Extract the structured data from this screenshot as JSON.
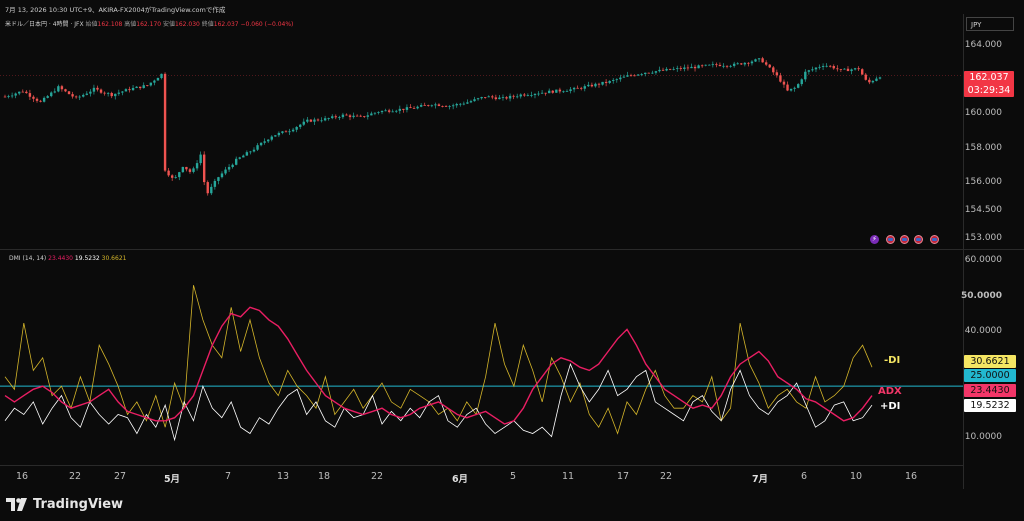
{
  "header": {
    "timestamp": "7月 13, 2026 10:30 UTC+9、AKIRA-FX2004がTradingView.comで作成",
    "symbol": "米ドル／日本円 · 4時間 · JFX",
    "ohlc_labels": {
      "open": "始値",
      "high": "高値",
      "low": "安値",
      "close": "終値"
    },
    "ohlc_values": {
      "open": "162.108",
      "high": "162.170",
      "low": "162.030",
      "close": "162.037"
    },
    "change": "−0.060 (−0.04%)"
  },
  "currency": "JPY",
  "price_axis": {
    "ticks": [
      "164.000",
      "162.000",
      "160.000",
      "158.000",
      "156.000",
      "154.500",
      "153.000"
    ],
    "current_price": "162.037",
    "countdown": "03:29:34"
  },
  "indicator": {
    "name": "DMI (14, 14)",
    "values": {
      "adx": "23.4430",
      "plus_di": "19.5232",
      "minus_di": "30.6621"
    },
    "axis_ticks": [
      "60.0000",
      "50.0000",
      "40.0000",
      "10.0000"
    ],
    "level_label": "25.0000",
    "legend": {
      "minus_di": "-DI",
      "adx": "ADX",
      "plus_di": "+DI"
    },
    "colors": {
      "adx": "#e91e63",
      "plus_di": "#ffffff",
      "minus_di": "#d4b52a",
      "level": "#22b8cf"
    }
  },
  "x_axis": {
    "labels": [
      "16",
      "22",
      "27",
      "5月",
      "7",
      "13",
      "18",
      "22",
      "6月",
      "5",
      "11",
      "17",
      "22",
      "7月",
      "6",
      "10",
      "16"
    ]
  },
  "branding": {
    "logo_text": "TradingView"
  },
  "chart_data": [
    {
      "type": "candlestick",
      "title": "米ドル／日本円 · 4時間 · JFX",
      "ylim": [
        152.8,
        165.0
      ],
      "period_range": [
        "16",
        "16"
      ],
      "points_approx": [
        [
          0,
          160.9
        ],
        [
          10,
          161.2
        ],
        [
          20,
          160.6
        ],
        [
          30,
          161.4
        ],
        [
          40,
          160.8
        ],
        [
          50,
          161.3
        ],
        [
          60,
          161.0
        ],
        [
          70,
          161.3
        ],
        [
          80,
          161.5
        ],
        [
          88,
          162.1
        ],
        [
          90,
          157.0
        ],
        [
          95,
          156.4
        ],
        [
          100,
          157.2
        ],
        [
          105,
          156.8
        ],
        [
          110,
          157.8
        ],
        [
          113,
          155.6
        ],
        [
          120,
          156.6
        ],
        [
          130,
          157.5
        ],
        [
          140,
          158.1
        ],
        [
          150,
          158.8
        ],
        [
          160,
          159.1
        ],
        [
          170,
          159.6
        ],
        [
          180,
          159.7
        ],
        [
          190,
          159.9
        ],
        [
          200,
          159.8
        ],
        [
          210,
          160.1
        ],
        [
          220,
          160.2
        ],
        [
          230,
          160.3
        ],
        [
          240,
          160.5
        ],
        [
          250,
          160.4
        ],
        [
          260,
          160.6
        ],
        [
          270,
          160.9
        ],
        [
          280,
          160.8
        ],
        [
          290,
          161.0
        ],
        [
          300,
          161.1
        ],
        [
          310,
          161.2
        ],
        [
          320,
          161.3
        ],
        [
          330,
          161.5
        ],
        [
          340,
          161.7
        ],
        [
          350,
          162.0
        ],
        [
          360,
          162.2
        ],
        [
          370,
          162.3
        ],
        [
          380,
          162.4
        ],
        [
          390,
          162.5
        ],
        [
          400,
          162.6
        ],
        [
          410,
          162.6
        ],
        [
          420,
          162.8
        ],
        [
          425,
          162.9
        ],
        [
          430,
          162.4
        ],
        [
          435,
          161.9
        ],
        [
          440,
          161.2
        ],
        [
          445,
          161.4
        ],
        [
          450,
          162.2
        ],
        [
          460,
          162.6
        ],
        [
          465,
          162.5
        ],
        [
          470,
          162.3
        ],
        [
          480,
          162.4
        ],
        [
          485,
          161.6
        ],
        [
          490,
          161.9
        ],
        [
          492,
          162.0
        ]
      ]
    },
    {
      "type": "line",
      "title": "DMI (14, 14)",
      "ylim": [
        0,
        65
      ],
      "reference_line": 25,
      "series": [
        {
          "name": "ADX",
          "values": [
            22,
            20,
            22,
            24,
            25,
            23,
            20,
            18,
            19,
            20,
            22,
            24,
            20,
            17,
            16,
            15,
            14,
            14,
            15,
            18,
            22,
            30,
            38,
            44,
            48,
            47,
            50,
            49,
            46,
            44,
            40,
            35,
            30,
            26,
            22,
            20,
            18,
            17,
            16,
            17,
            18,
            16,
            15,
            16,
            18,
            19,
            20,
            18,
            16,
            15,
            16,
            17,
            15,
            13,
            14,
            18,
            24,
            28,
            32,
            34,
            33,
            31,
            30,
            32,
            36,
            40,
            43,
            38,
            32,
            28,
            24,
            22,
            20,
            18,
            19,
            18,
            22,
            28,
            32,
            34,
            36,
            33,
            28,
            26,
            24,
            21,
            20,
            18,
            16,
            14,
            15,
            18,
            22
          ]
        },
        {
          "name": "+DI",
          "values": [
            14,
            18,
            16,
            20,
            13,
            18,
            22,
            15,
            12,
            20,
            16,
            13,
            16,
            15,
            10,
            16,
            12,
            19,
            8,
            20,
            14,
            25,
            18,
            15,
            20,
            12,
            10,
            15,
            13,
            18,
            22,
            24,
            16,
            20,
            14,
            12,
            18,
            15,
            16,
            22,
            13,
            17,
            14,
            18,
            15,
            20,
            22,
            14,
            12,
            16,
            18,
            13,
            10,
            12,
            14,
            11,
            10,
            12,
            9,
            22,
            32,
            25,
            20,
            24,
            30,
            22,
            24,
            28,
            30,
            20,
            18,
            16,
            14,
            20,
            22,
            17,
            14,
            24,
            30,
            22,
            18,
            16,
            20,
            22,
            26,
            19,
            12,
            14,
            19,
            20,
            14,
            15,
            19
          ]
        },
        {
          "name": "-DI",
          "values": [
            28,
            24,
            45,
            30,
            34,
            22,
            25,
            18,
            28,
            20,
            38,
            32,
            25,
            16,
            20,
            14,
            22,
            12,
            26,
            18,
            57,
            46,
            38,
            34,
            50,
            36,
            46,
            34,
            26,
            22,
            30,
            25,
            22,
            18,
            28,
            16,
            20,
            24,
            18,
            22,
            26,
            20,
            18,
            24,
            22,
            20,
            16,
            18,
            14,
            20,
            16,
            28,
            45,
            32,
            25,
            38,
            30,
            20,
            34,
            28,
            20,
            26,
            16,
            12,
            18,
            10,
            20,
            16,
            24,
            30,
            22,
            18,
            18,
            22,
            20,
            28,
            14,
            18,
            45,
            32,
            26,
            18,
            22,
            24,
            20,
            18,
            28,
            20,
            22,
            25,
            34,
            38,
            31
          ]
        }
      ]
    }
  ]
}
